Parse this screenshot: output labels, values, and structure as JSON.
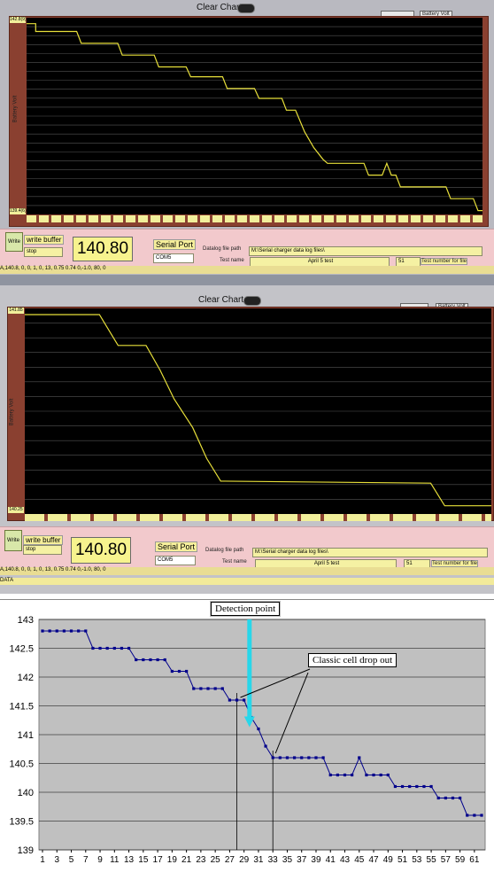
{
  "screen1": {
    "clear_chart": "Clear Chart",
    "battery_volt": "Battery Volt",
    "ytop": "142.8(9)",
    "ybottom": "139.4(6)",
    "ylabel": "Battery Volt",
    "write_btn": "Write",
    "write_buffer": "write buffer",
    "write_value": "stop",
    "value": "140.80",
    "serial_port": "Serial Port",
    "com": "COM5",
    "datalog_label": "Datalog file path",
    "datalog_path": "M:\\Serial charger data log files\\",
    "test_name_label": "Test name",
    "test_name": "April 5 test",
    "test_number": "51",
    "test_number_label": "Test number for file",
    "status": "A,140.8,  0,  0, 1, 0,  13,   0.75 0.74 0,-1.0,  80,  0"
  },
  "screen2": {
    "clear_chart": "Clear Chart",
    "battery_volt": "Battery Volt",
    "ytop": "141.85",
    "ybottom": "140.25",
    "ylabel": "Battery Volt",
    "write_btn": "Write",
    "write_buffer": "write buffer",
    "write_value": "stop",
    "value": "140.80",
    "serial_port": "Serial Port",
    "com": "COM5",
    "datalog_label": "Datalog file path",
    "datalog_path": "M:\\Serial charger data log files\\",
    "test_name_label": "Test name",
    "test_name": "April 5 test",
    "test_number": "51",
    "test_number_label": "Test number for file",
    "status": "A,140.8,  0,  0, 1, 0,  13,   0.75 0.74 0,-1.0,  80,  0",
    "status2": "DATA"
  },
  "annotations": {
    "detection": "Detection point",
    "classic": "Classic cell drop out"
  },
  "chart_data": {
    "type": "line",
    "x": [
      1,
      2,
      3,
      4,
      5,
      6,
      7,
      8,
      9,
      10,
      11,
      12,
      13,
      14,
      15,
      16,
      17,
      18,
      19,
      20,
      21,
      22,
      23,
      24,
      25,
      26,
      27,
      28,
      29,
      30,
      31,
      32,
      33,
      34,
      35,
      36,
      37,
      38,
      39,
      40,
      41,
      42,
      43,
      44,
      45,
      46,
      47,
      48,
      49,
      50,
      51,
      52,
      53,
      54,
      55,
      56,
      57,
      58,
      59,
      60,
      61,
      62
    ],
    "values": [
      142.8,
      142.8,
      142.8,
      142.8,
      142.8,
      142.8,
      142.8,
      142.5,
      142.5,
      142.5,
      142.5,
      142.5,
      142.5,
      142.3,
      142.3,
      142.3,
      142.3,
      142.3,
      142.1,
      142.1,
      142.1,
      141.8,
      141.8,
      141.8,
      141.8,
      141.8,
      141.6,
      141.6,
      141.6,
      141.3,
      141.1,
      140.8,
      140.6,
      140.6,
      140.6,
      140.6,
      140.6,
      140.6,
      140.6,
      140.6,
      140.3,
      140.3,
      140.3,
      140.3,
      140.6,
      140.3,
      140.3,
      140.3,
      140.3,
      140.1,
      140.1,
      140.1,
      140.1,
      140.1,
      140.1,
      139.9,
      139.9,
      139.9,
      139.9,
      139.6,
      139.6,
      139.6
    ],
    "xticks": [
      "1",
      "3",
      "5",
      "7",
      "9",
      "11",
      "13",
      "15",
      "17",
      "19",
      "21",
      "23",
      "25",
      "27",
      "29",
      "31",
      "33",
      "35",
      "37",
      "39",
      "41",
      "43",
      "45",
      "47",
      "49",
      "51",
      "53",
      "55",
      "57",
      "59",
      "61"
    ],
    "yticks": [
      "139",
      "139.5",
      "140",
      "140.5",
      "141",
      "141.5",
      "142",
      "142.5",
      "143"
    ],
    "ylim": [
      139,
      143
    ],
    "color": "#00008b",
    "plot_bg": "#c0c0c0",
    "grid": true
  }
}
